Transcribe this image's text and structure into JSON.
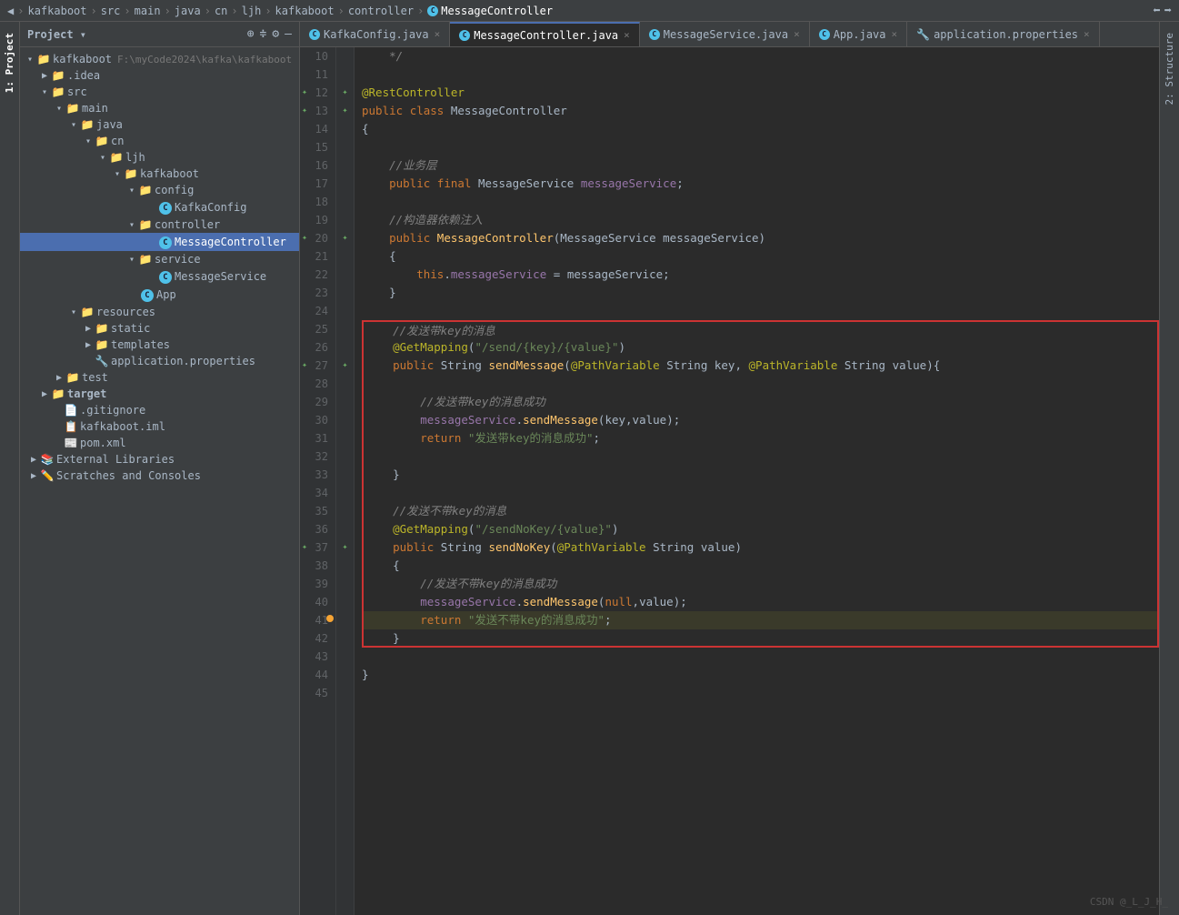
{
  "breadcrumb": {
    "items": [
      "kafkaboot",
      "src",
      "main",
      "java",
      "cn",
      "ljh",
      "kafkaboot",
      "controller"
    ],
    "current": "MessageController",
    "separator": "›"
  },
  "tabs": [
    {
      "label": "KafkaConfig.java",
      "type": "java",
      "active": false,
      "modified": false
    },
    {
      "label": "MessageController.java",
      "type": "java",
      "active": true,
      "modified": false
    },
    {
      "label": "MessageService.java",
      "type": "java",
      "active": false,
      "modified": false
    },
    {
      "label": "App.java",
      "type": "java",
      "active": false,
      "modified": false
    },
    {
      "label": "application.properties",
      "type": "properties",
      "active": false,
      "modified": false
    }
  ],
  "project": {
    "title": "Project",
    "root": {
      "name": "kafkaboot",
      "path": "F:\\myCode2024\\kafka\\kafkaboot",
      "children": [
        {
          "name": ".idea",
          "type": "folder",
          "level": 1,
          "expanded": false
        },
        {
          "name": "src",
          "type": "folder",
          "level": 1,
          "expanded": true,
          "children": [
            {
              "name": "main",
              "type": "folder",
              "level": 2,
              "expanded": true,
              "children": [
                {
                  "name": "java",
                  "type": "folder",
                  "level": 3,
                  "expanded": true,
                  "children": [
                    {
                      "name": "cn",
                      "type": "folder",
                      "level": 4,
                      "expanded": true,
                      "children": [
                        {
                          "name": "ljh",
                          "type": "folder",
                          "level": 5,
                          "expanded": true,
                          "children": [
                            {
                              "name": "kafkaboot",
                              "type": "folder",
                              "level": 6,
                              "expanded": true,
                              "children": [
                                {
                                  "name": "config",
                                  "type": "folder",
                                  "level": 7,
                                  "expanded": true,
                                  "children": [
                                    {
                                      "name": "KafkaConfig",
                                      "type": "java",
                                      "level": 8
                                    }
                                  ]
                                },
                                {
                                  "name": "controller",
                                  "type": "folder",
                                  "level": 7,
                                  "expanded": true,
                                  "children": [
                                    {
                                      "name": "MessageController",
                                      "type": "java",
                                      "level": 8,
                                      "selected": true
                                    }
                                  ]
                                },
                                {
                                  "name": "service",
                                  "type": "folder",
                                  "level": 7,
                                  "expanded": true,
                                  "children": [
                                    {
                                      "name": "MessageService",
                                      "type": "java",
                                      "level": 8
                                    }
                                  ]
                                },
                                {
                                  "name": "App",
                                  "type": "java",
                                  "level": 7
                                }
                              ]
                            }
                          ]
                        }
                      ]
                    }
                  ]
                },
                {
                  "name": "resources",
                  "type": "folder",
                  "level": 3,
                  "expanded": true,
                  "children": [
                    {
                      "name": "static",
                      "type": "folder",
                      "level": 4,
                      "expanded": false
                    },
                    {
                      "name": "templates",
                      "type": "folder",
                      "level": 4,
                      "expanded": false
                    },
                    {
                      "name": "application.properties",
                      "type": "properties",
                      "level": 4
                    }
                  ]
                }
              ]
            },
            {
              "name": "test",
              "type": "folder",
              "level": 2,
              "expanded": false
            }
          ]
        },
        {
          "name": "target",
          "type": "folder",
          "level": 1,
          "expanded": false,
          "bold": true
        },
        {
          "name": ".gitignore",
          "type": "gitignore",
          "level": 1
        },
        {
          "name": "kafkaboot.iml",
          "type": "iml",
          "level": 1
        },
        {
          "name": "pom.xml",
          "type": "xml",
          "level": 1
        }
      ]
    }
  },
  "code": {
    "lines": [
      {
        "num": 10,
        "content": "    */",
        "gutter": ""
      },
      {
        "num": 11,
        "content": "",
        "gutter": ""
      },
      {
        "num": 12,
        "content": "@RestController",
        "gutter": "green"
      },
      {
        "num": 13,
        "content": "public class MessageController",
        "gutter": "green"
      },
      {
        "num": 14,
        "content": "{",
        "gutter": ""
      },
      {
        "num": 15,
        "content": "",
        "gutter": ""
      },
      {
        "num": 16,
        "content": "    //业务层",
        "gutter": ""
      },
      {
        "num": 17,
        "content": "    public final MessageService messageService;",
        "gutter": ""
      },
      {
        "num": 18,
        "content": "",
        "gutter": ""
      },
      {
        "num": 19,
        "content": "    //构造器依赖注入",
        "gutter": ""
      },
      {
        "num": 20,
        "content": "    public MessageController(MessageService messageService)",
        "gutter": "green"
      },
      {
        "num": 21,
        "content": "    {",
        "gutter": ""
      },
      {
        "num": 22,
        "content": "        this.messageService = messageService;",
        "gutter": ""
      },
      {
        "num": 23,
        "content": "    }",
        "gutter": ""
      },
      {
        "num": 24,
        "content": "",
        "gutter": ""
      },
      {
        "num": 25,
        "content": "    //发送带key的消息",
        "gutter": "",
        "redbox": "start"
      },
      {
        "num": 26,
        "content": "    @GetMapping(\"/send/{key}/{value}\")",
        "gutter": ""
      },
      {
        "num": 27,
        "content": "    public String sendMessage(@PathVariable String key, @PathVariable String value){",
        "gutter": "green"
      },
      {
        "num": 28,
        "content": "",
        "gutter": ""
      },
      {
        "num": 29,
        "content": "        //发送带key的消息成功",
        "gutter": ""
      },
      {
        "num": 30,
        "content": "        messageService.sendMessage(key,value);",
        "gutter": ""
      },
      {
        "num": 31,
        "content": "        return \"发送带key的消息成功\";",
        "gutter": ""
      },
      {
        "num": 32,
        "content": "",
        "gutter": ""
      },
      {
        "num": 33,
        "content": "    }",
        "gutter": ""
      },
      {
        "num": 34,
        "content": "",
        "gutter": ""
      },
      {
        "num": 35,
        "content": "    //发送不带key的消息",
        "gutter": ""
      },
      {
        "num": 36,
        "content": "    @GetMapping(\"/sendNoKey/{value}\")",
        "gutter": ""
      },
      {
        "num": 37,
        "content": "    public String sendNoKey(@PathVariable String value)",
        "gutter": "green"
      },
      {
        "num": 38,
        "content": "    {",
        "gutter": ""
      },
      {
        "num": 39,
        "content": "        //发送不带key的消息成功",
        "gutter": ""
      },
      {
        "num": 40,
        "content": "        messageService.sendMessage(null,value);",
        "gutter": ""
      },
      {
        "num": 41,
        "content": "        return \"发送不带key的消息成功\";",
        "gutter": "orange"
      },
      {
        "num": 42,
        "content": "    }",
        "gutter": "",
        "redbox": "end"
      },
      {
        "num": 43,
        "content": "",
        "gutter": ""
      },
      {
        "num": 44,
        "content": "}",
        "gutter": ""
      },
      {
        "num": 45,
        "content": "",
        "gutter": ""
      }
    ]
  },
  "watermark": "CSDN @_L_J_H_",
  "side_labels": {
    "panel1": "1: Project",
    "panel2": "2: Structure"
  }
}
